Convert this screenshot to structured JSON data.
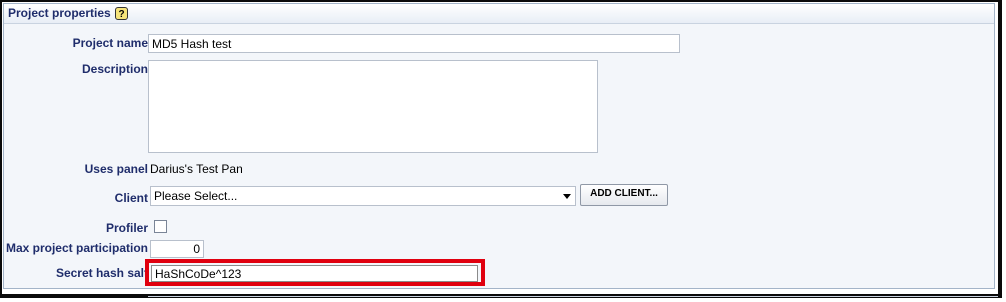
{
  "header": {
    "title": "Project properties",
    "help_icon": "?"
  },
  "fields": {
    "project_name": {
      "label": "Project name",
      "value": "MD5 Hash test"
    },
    "description": {
      "label": "Description",
      "value": ""
    },
    "uses_panel": {
      "label": "Uses panel",
      "value": "Darius's Test Panel"
    },
    "client": {
      "label": "Client",
      "selected": "Please Select...",
      "add_button": "ADD CLIENT..."
    },
    "profiler": {
      "label": "Profiler",
      "checked": false
    },
    "max_participation": {
      "label": "Max project participation",
      "value": "0"
    },
    "secret_hash_salt": {
      "label": "Secret hash salt",
      "value": "HaShCoDe^123"
    }
  },
  "colors": {
    "label_text": "#1f2d6b",
    "highlight": "#e0000f",
    "panel_border": "#a3b4c8"
  }
}
